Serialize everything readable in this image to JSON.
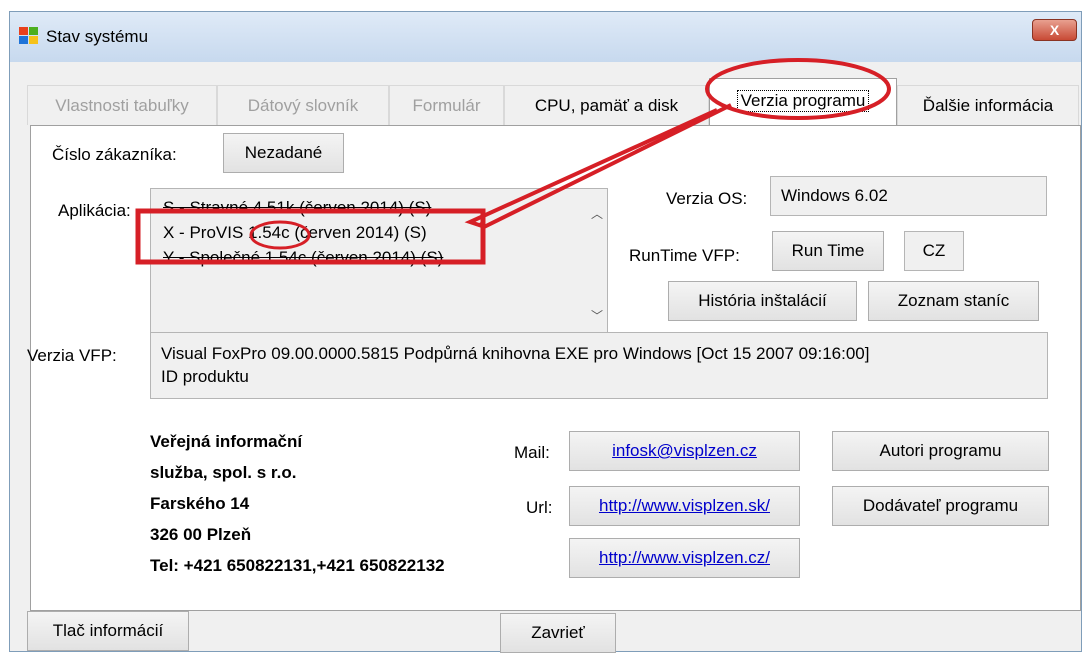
{
  "window": {
    "title": "Stav systému",
    "close_label": "X"
  },
  "tabs": [
    {
      "label": "Vlastnosti tabuľky",
      "state": "disabled"
    },
    {
      "label": "Dátový slovník",
      "state": "disabled"
    },
    {
      "label": "Formulár",
      "state": "disabled"
    },
    {
      "label": "CPU, pamäť a disk",
      "state": "normal"
    },
    {
      "label": "Verzia programu",
      "state": "active"
    },
    {
      "label": "Ďalšie informácia",
      "state": "normal"
    }
  ],
  "customer": {
    "label": "Číslo zákazníka:",
    "value": "Nezadané"
  },
  "application": {
    "label": "Aplikácia:",
    "items": [
      "S - Stravné 4.51k (červen 2014) (S)",
      "X - ProVIS 1.54c (červen 2014) (S)",
      "Y - Společné 1.54c (červen 2014) (S)"
    ]
  },
  "os": {
    "label": "Verzia OS:",
    "value": "Windows 6.02"
  },
  "runtime": {
    "label": "RunTime VFP:",
    "button": "Run Time",
    "lang": "CZ"
  },
  "history_button": "História inštalácií",
  "stations_button": "Zoznam staníc",
  "vfp": {
    "label": "Verzia VFP:",
    "line1": "Visual FoxPro 09.00.0000.5815 Podpůrná knihovna EXE  pro Windows [Oct 15 2007 09:16:00]",
    "line2": "ID produktu"
  },
  "company": {
    "line1": "Veřejná informační",
    "line2": "služba, spol. s r.o.",
    "line3": "Farského 14",
    "line4": "326 00  Plzeň",
    "line5": "Tel: +421 650822131,+421 650822132"
  },
  "contact": {
    "mail_label": "Mail:",
    "mail": "infosk@visplzen.cz",
    "url_label": "Url:",
    "url1": "http://www.visplzen.sk/",
    "url2": "http://www.visplzen.cz/"
  },
  "authors_button": "Autori programu",
  "supplier_button": "Dodávateľ programu",
  "print_button": "Tlač informácií",
  "close_button": "Zavrieť",
  "colors": {
    "annotation": "#d61f26",
    "link": "#0000cc",
    "title_gradient": "#c7d9ee"
  },
  "icons": [
    "windows-logo-icon",
    "close-icon",
    "scroll-up-icon",
    "scroll-down-icon"
  ]
}
